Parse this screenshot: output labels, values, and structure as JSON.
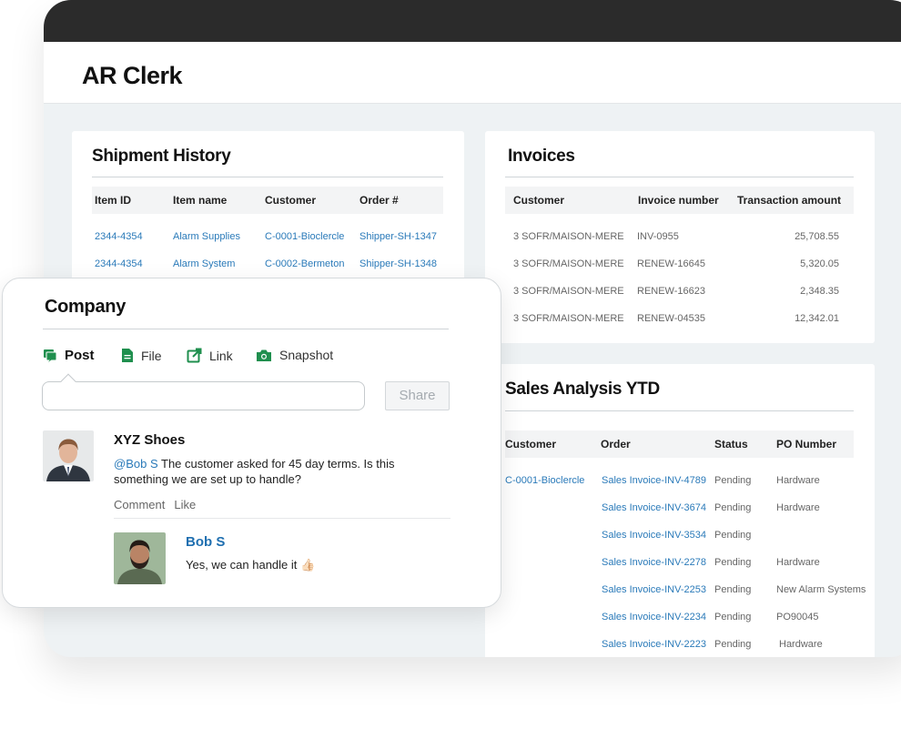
{
  "app": {
    "title": "AR Clerk"
  },
  "shipment_history": {
    "title": "Shipment History",
    "columns": [
      "Item ID",
      "Item name",
      "Customer",
      "Order #"
    ],
    "rows": [
      [
        "2344-4354",
        "Alarm Supplies",
        "C-0001-Bioclercle",
        "Shipper-SH-1347"
      ],
      [
        "2344-4354",
        "Alarm System",
        "C-0002-Bermeton",
        "Shipper-SH-1348"
      ]
    ]
  },
  "invoices": {
    "title": "Invoices",
    "columns": [
      "Customer",
      "Invoice number",
      "Transaction amount"
    ],
    "rows": [
      [
        "3 SOFR/MAISON-MERE",
        "INV-0955",
        "25,708.55"
      ],
      [
        "3 SOFR/MAISON-MERE",
        "RENEW-16645",
        "5,320.05"
      ],
      [
        "3 SOFR/MAISON-MERE",
        "RENEW-16623",
        "2,348.35"
      ],
      [
        "3 SOFR/MAISON-MERE",
        "RENEW-04535",
        "12,342.01"
      ]
    ]
  },
  "sales_analysis": {
    "title": "Sales Analysis YTD",
    "columns": [
      "Customer",
      "Order",
      "Status",
      "PO Number"
    ],
    "rows": [
      [
        "C-0001-Bioclercle",
        "Sales Invoice-INV-4789",
        "Pending",
        "Hardware"
      ],
      [
        "",
        "Sales Invoice-INV-3674",
        "Pending",
        "Hardware"
      ],
      [
        "",
        "Sales Invoice-INV-3534",
        "Pending",
        ""
      ],
      [
        "",
        "Sales Invoice-INV-2278",
        "Pending",
        "Hardware"
      ],
      [
        "",
        "Sales Invoice-INV-2253",
        "Pending",
        "New Alarm Systems"
      ],
      [
        "",
        "Sales Invoice-INV-2234",
        "Pending",
        "PO90045"
      ],
      [
        "",
        "Sales Invoice-INV-2223",
        "Pending",
        "Hardware"
      ]
    ]
  },
  "company": {
    "title": "Company",
    "tabs": [
      {
        "label": "Post",
        "icon": "post-icon"
      },
      {
        "label": "File",
        "icon": "file-icon"
      },
      {
        "label": "Link",
        "icon": "link-icon"
      },
      {
        "label": "Snapshot",
        "icon": "camera-icon"
      }
    ],
    "compose_placeholder": "",
    "share_label": "Share",
    "post": {
      "author": "XYZ Shoes",
      "mention": "@Bob S",
      "text": " The customer asked for 45 day terms. Is this something we are set up to handle?",
      "comment_label": "Comment",
      "like_label": "Like"
    },
    "reply": {
      "author": "Bob S",
      "text": "Yes, we can handle it 👍🏻"
    }
  },
  "colors": {
    "titlebar": "#2b2b2b",
    "link": "#2a7ab9",
    "accent_green": "#1f8f4e",
    "background": "#eef2f4"
  }
}
